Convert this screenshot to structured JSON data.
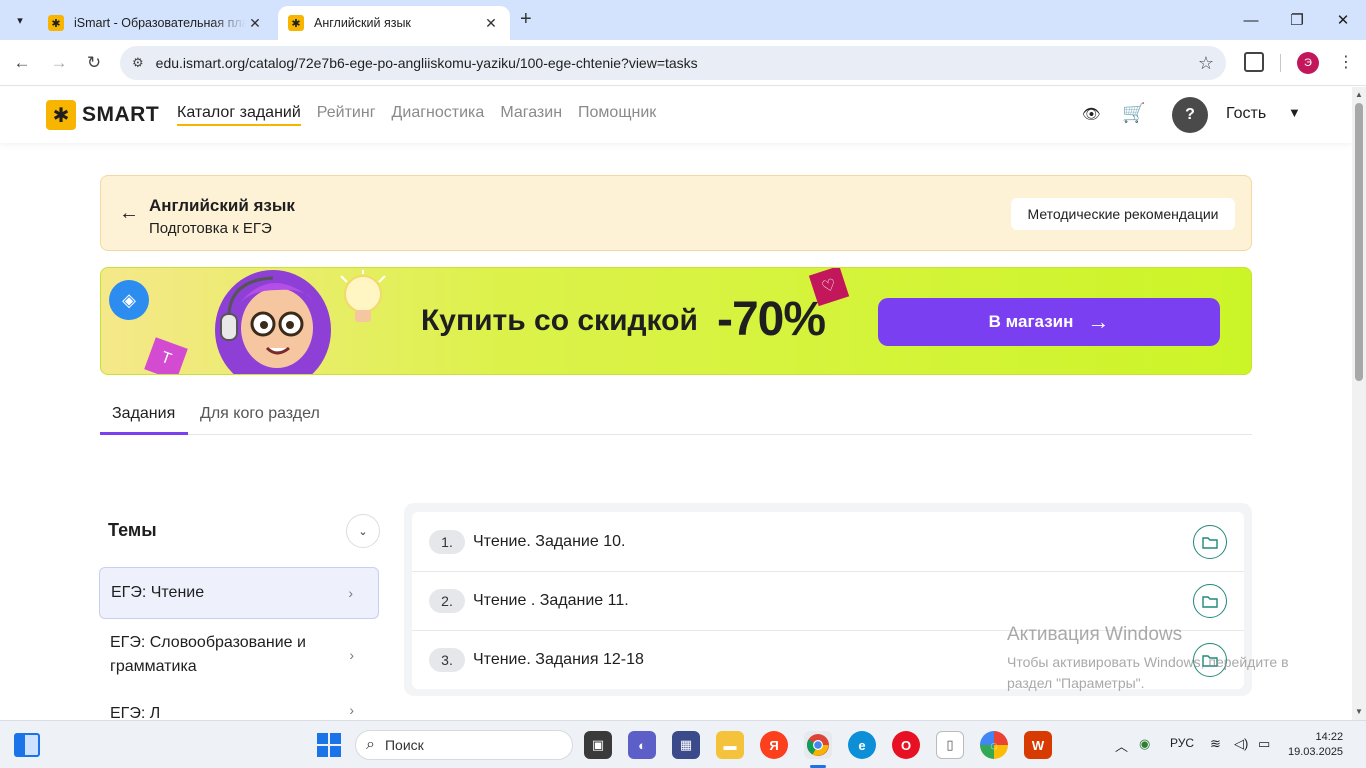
{
  "browser": {
    "tabs": [
      {
        "title": "iSmart - Образовательная пла",
        "active": false
      },
      {
        "title": "Английский язык",
        "active": true
      }
    ],
    "url": "edu.ismart.org/catalog/72e7b6-ege-po-angliiskomu-yaziku/100-ege-chtenie?view=tasks",
    "profile_initial": "Э"
  },
  "header": {
    "logo_text": "SMART",
    "nav": [
      {
        "label": "Каталог заданий",
        "active": true
      },
      {
        "label": "Рейтинг",
        "active": false
      },
      {
        "label": "Диагностика",
        "active": false
      },
      {
        "label": "Магазин",
        "active": false
      },
      {
        "label": "Помощник",
        "active": false
      }
    ],
    "help_label": "?",
    "user_label": "Гость"
  },
  "subject": {
    "title": "Английский язык",
    "subtitle": "Подготовка к ЕГЭ",
    "guide_button": "Методические рекомендации"
  },
  "promo": {
    "text": "Купить со скидкой",
    "discount": "-70%",
    "button": "В магазин"
  },
  "page_tabs": [
    {
      "label": "Задания",
      "active": true
    },
    {
      "label": "Для кого раздел",
      "active": false
    }
  ],
  "topics": {
    "title": "Темы",
    "items": [
      {
        "label": "ЕГЭ: Чтение",
        "selected": true
      },
      {
        "label": "ЕГЭ: Словообразование и грамматика",
        "selected": false
      },
      {
        "label": "ЕГЭ: Л",
        "selected": false
      }
    ]
  },
  "tasks": [
    {
      "num": "1.",
      "title": "Чтение. Задание 10."
    },
    {
      "num": "2.",
      "title": "Чтение . Задание 11."
    },
    {
      "num": "3.",
      "title": "Чтение. Задания 12-18"
    }
  ],
  "watermark": {
    "title": "Активация Windows",
    "subtitle": "Чтобы активировать Windows, перейдите в раздел \"Параметры\"."
  },
  "taskbar": {
    "search_placeholder": "Поиск",
    "language": "РУС",
    "time": "14:22",
    "date": "19.03.2025"
  },
  "colors": {
    "accent_purple": "#7b3ff2",
    "brand_yellow": "#f7b500",
    "folder_teal": "#1e8a7a"
  }
}
